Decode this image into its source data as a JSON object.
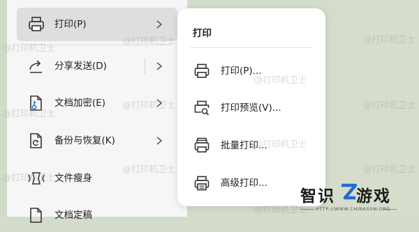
{
  "watermark_text": "@打印机卫士",
  "menu": {
    "items": [
      {
        "label": "打印(P)",
        "icon": "printer-icon",
        "chevron": true,
        "active": true
      },
      {
        "label": "分享发送(D)",
        "icon": "share-arrow-icon",
        "chevron": true
      },
      {
        "label": "文档加密(E)",
        "icon": "document-key-icon",
        "chevron": true
      },
      {
        "label": "备份与恢复(K)",
        "icon": "backup-restore-icon",
        "chevron": true
      },
      {
        "label": "文件瘦身",
        "icon": "file-slim-icon",
        "chevron": false
      },
      {
        "label": "文档定稿",
        "icon": "document-finalize-icon",
        "chevron": false
      }
    ]
  },
  "submenu": {
    "title": "打印",
    "items": [
      {
        "label": "打印(P)...",
        "icon": "printer-icon"
      },
      {
        "label": "打印预览(V)...",
        "icon": "print-preview-icon"
      },
      {
        "label": "批量打印...",
        "icon": "batch-print-icon"
      },
      {
        "label": "高级打印...",
        "icon": "advanced-print-icon"
      }
    ]
  },
  "brand": {
    "part1": "智识",
    "part2": "游戏",
    "url": "HTTP://WWW.CHINASSW.ORG"
  },
  "colors": {
    "menu_bg": "#f6f6f6",
    "active_bg": "#dedede",
    "submenu_bg": "#ffffff",
    "brand_accent": "#1e6bd6"
  }
}
